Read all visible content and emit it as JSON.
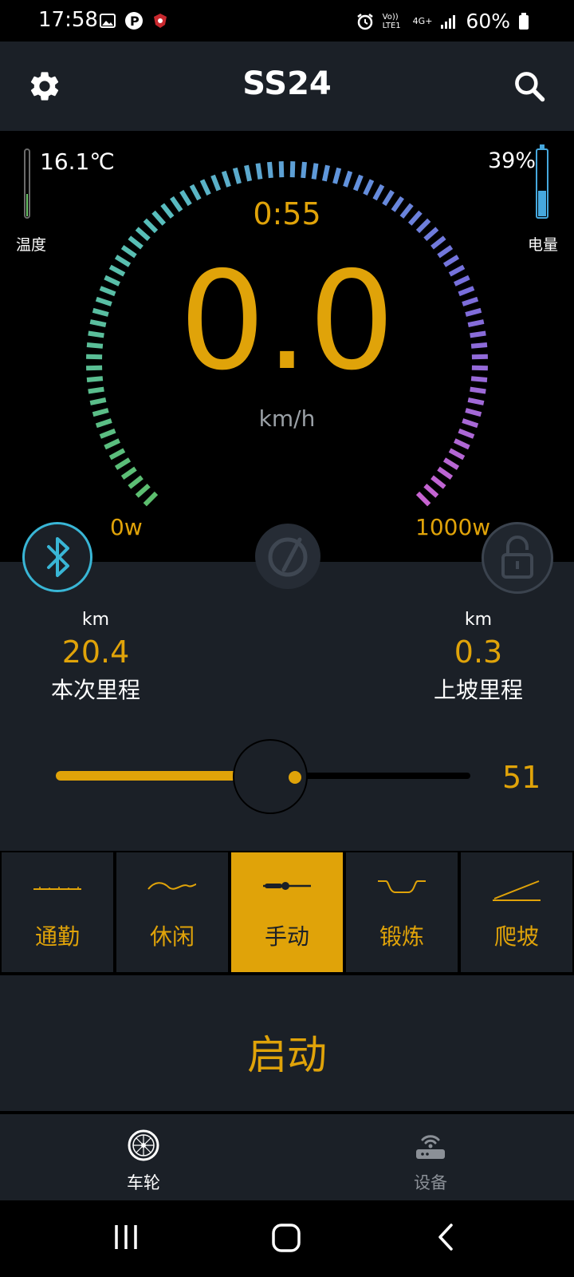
{
  "status_bar": {
    "time": "17:58",
    "battery": "60%",
    "network": "4G+",
    "volte": "Vo)) LTE1"
  },
  "header": {
    "title": "SS24",
    "settings_icon": "gear-icon",
    "search_icon": "search-icon"
  },
  "dashboard": {
    "temperature": "16.1℃",
    "temperature_label": "温度",
    "battery_pct": "39%",
    "battery_level": 0.39,
    "battery_label": "电量",
    "timer": "0:55",
    "speed": "0.0",
    "speed_unit": "km/h",
    "power_min": "0w",
    "power_max": "1000w",
    "accent_color": "#e0a309"
  },
  "stats": {
    "trip": {
      "unit": "km",
      "value": "20.4",
      "label": "本次里程"
    },
    "climb": {
      "unit": "km",
      "value": "0.3",
      "label": "上坡里程"
    }
  },
  "slider": {
    "value": "51",
    "level": 0.51
  },
  "modes": [
    {
      "label": "通勤",
      "icon": "commute-wave-icon",
      "active": false
    },
    {
      "label": "休闲",
      "icon": "leisure-wave-icon",
      "active": false
    },
    {
      "label": "手动",
      "icon": "manual-slider-icon",
      "active": true
    },
    {
      "label": "锻炼",
      "icon": "exercise-curve-icon",
      "active": false
    },
    {
      "label": "爬坡",
      "icon": "climb-slope-icon",
      "active": false
    }
  ],
  "start_label": "启动",
  "tabs": [
    {
      "label": "车轮",
      "icon": "wheel-icon",
      "active": true
    },
    {
      "label": "设备",
      "icon": "router-icon",
      "active": false
    }
  ]
}
